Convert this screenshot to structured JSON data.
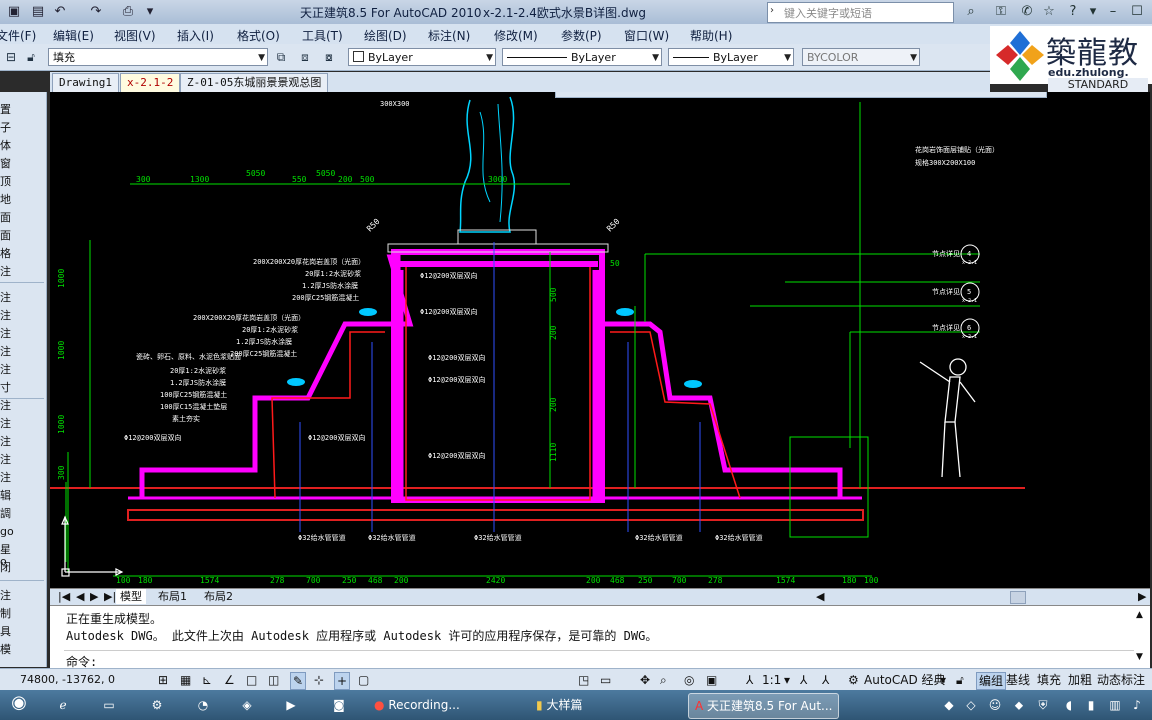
{
  "titlebar": {
    "app_title": "天正建筑8.5 For AutoCAD 2010",
    "file_title": "x-2.1-2.4欧式水景B详图.dwg",
    "search_placeholder": "键入关键字或短语"
  },
  "menu": {
    "items": [
      "文件(F)",
      "编辑(E)",
      "视图(V)",
      "插入(I)",
      "格式(O)",
      "工具(T)",
      "绘图(D)",
      "标注(N)",
      "修改(M)",
      "参数(P)",
      "窗口(W)",
      "帮助(H)"
    ]
  },
  "toolbar": {
    "hatch_combo": "填充",
    "layer_color": "ByLayer",
    "linetype": "ByLayer",
    "lineweight": "ByLayer",
    "plotstyle": "BYCOLOR",
    "dimstyle": "STANDARD"
  },
  "logo": {
    "text": "築龍教",
    "url": "edu.zhulong."
  },
  "doc_tabs": [
    "Drawing1",
    "x-2.1-2",
    "Z-01-05东城丽景景观总图"
  ],
  "active_doc_tab": "x-2.1-2",
  "left_palette": {
    "items": [
      "置",
      "子",
      "体",
      "窗",
      "顶",
      "地",
      "面",
      "面",
      "格",
      "注",
      "注",
      "注",
      "注",
      "注",
      "注",
      "寸",
      "注",
      "注",
      "注",
      "注",
      "注",
      "辑",
      "調",
      "go",
      "星o",
      "闭",
      "注",
      "制",
      "具",
      "模"
    ]
  },
  "drawing": {
    "top_dims": [
      "300",
      "1300",
      "5050",
      "550",
      "5050",
      "200",
      "500",
      "3000"
    ],
    "bottom_dims": [
      "100",
      "180",
      "1574",
      "278",
      "700",
      "250",
      "468",
      "200",
      "2420",
      "200",
      "468",
      "250",
      "700",
      "278",
      "1574",
      "180",
      "100"
    ],
    "left_dims": [
      "1000",
      "1000",
      "1000",
      "300"
    ],
    "right_dims": [
      "500",
      "200",
      "200",
      "1110"
    ],
    "angle_labels": [
      "R50",
      "R50"
    ],
    "dim_50": "50",
    "notes_left": [
      "200X200X20厚花岗岩盖顶（光面）",
      "20厚1:2水泥砂浆",
      "1.2厚JS防水涂膜",
      "200厚C25钢筋混凝土",
      "200X200X20厚花岗岩盖顶（光面）",
      "20厚1:2水泥砂浆",
      "1.2厚JS防水涂膜",
      "200厚C25钢筋混凝土",
      "瓷砖、卵石、原料、水泥色浆贴面",
      "20厚1:2水泥砂浆",
      "1.2厚JS防水涂膜",
      "100厚C25钢筋混凝土",
      "100厚C15混凝土垫层",
      "素土夯实"
    ],
    "rebar_labels": [
      "Φ12@200双层双向",
      "Φ12@200双层双向",
      "Φ12@200双层双向",
      "Φ12@200双层双向",
      "Φ12@200双层双向",
      "Φ12@200双层双向",
      "Φ12@200双层双向"
    ],
    "pipe_labels": [
      "Φ32给水管管道",
      "Φ32给水管管道",
      "Φ32给水管管道",
      "Φ32给水管管道",
      "Φ32给水管管道"
    ],
    "top_right_note": "花岗岩饰面层铺贴（光面）",
    "top_right_note2": "规格300X200X100",
    "top_note": "300X300",
    "detail_callouts": [
      {
        "label": "节点详见",
        "num": "4",
        "sheet": "x-2.1"
      },
      {
        "label": "节点详见",
        "num": "5",
        "sheet": "x-2.1"
      },
      {
        "label": "节点详见",
        "num": "6",
        "sheet": "x-2.1"
      }
    ],
    "colors": {
      "structure": "#ff00ff",
      "rebar": "#ff1a1a",
      "dimension": "#00e000",
      "note": "#ffffff",
      "sculpture": "#00d5ff",
      "ground": "#e02020",
      "person": "#ffffff"
    }
  },
  "layout_tabs": [
    "模型",
    "布局1",
    "布局2"
  ],
  "active_layout_tab": "模型",
  "command": {
    "line1": "正在重生成模型。",
    "line2": "Autodesk DWG。  此文件上次由 Autodesk 应用程序或 Autodesk 许可的应用程序保存，是可靠的 DWG。",
    "prompt": "命令:"
  },
  "status": {
    "coords": "74800, -13762, 0",
    "scale": "1:1",
    "workspace": "AutoCAD 经典",
    "buttons": [
      "编组",
      "基线",
      "填充",
      "加粗",
      "动态标注"
    ],
    "active_button": "编组"
  },
  "taskbar": {
    "tasks": [
      "Recording...",
      "大样篇",
      "天正建筑8.5 For Aut..."
    ],
    "active_task": "天正建筑8.5 For Aut..."
  }
}
